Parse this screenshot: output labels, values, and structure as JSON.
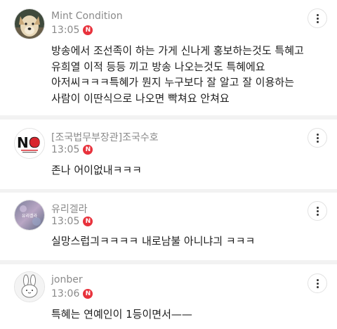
{
  "comments": [
    {
      "author": "Mint Condition",
      "time": "13:05",
      "new_badge": "N",
      "lines": [
        "방송에서 조선족이 하는 가게 신나게 홍보하는것도 특혜고",
        "유희열 이적 등등 끼고 방송 나오는것도 특혜에요",
        "아저씨ㅋㅋㅋ특혜가 뭔지 누구보다 잘 알고 잘 이용하는",
        "사람이 이딴식으로 나오면 빡쳐요 안쳐요"
      ]
    },
    {
      "author": "[조국법무부장관]조국수호",
      "time": "13:05",
      "new_badge": "N",
      "lines": [
        "존나 어이없내ㅋㅋㅋ"
      ]
    },
    {
      "author": "유리겔라",
      "time": "13:05",
      "new_badge": "N",
      "lines": [
        "실망스럽긔ㅋㅋㅋㅋ 내로남불 아니냐긔 ㅋㅋㅋ"
      ]
    },
    {
      "author": "jonber",
      "time": "13:06",
      "new_badge": "N",
      "lines": [
        "특혜는 연예인이 1등이면서——"
      ]
    }
  ],
  "avatars": {
    "no_logo": {
      "big_text": "NO"
    },
    "glass": {
      "label": "유리겔라"
    }
  },
  "colors": {
    "badge": "#e8323c",
    "separator": "#f2f2f2",
    "meta_text": "#8a8a8a",
    "body_text": "#1e1e1e"
  },
  "icons": [
    "more-options-icon",
    "new-badge"
  ]
}
